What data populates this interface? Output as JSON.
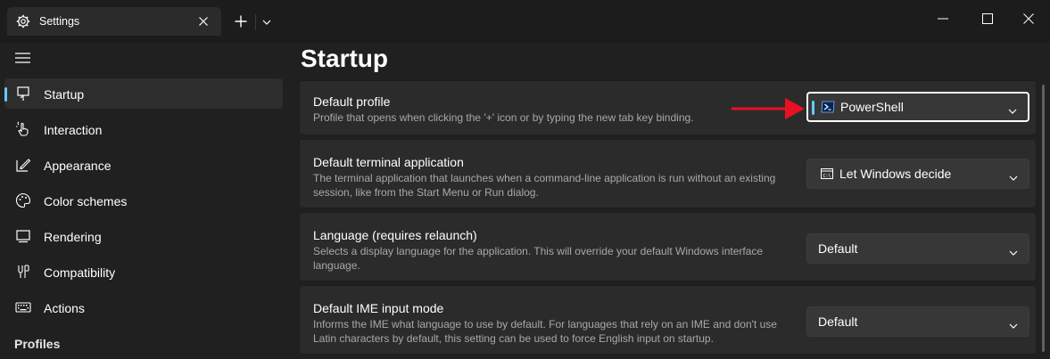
{
  "window": {
    "tab_title": "Settings",
    "icons": {
      "tab": "gear-icon",
      "close": "close-icon",
      "new_tab": "plus-icon",
      "dropdown": "chevron-down-icon",
      "minimize": "minimize-icon",
      "maximize": "maximize-icon",
      "close_window": "close-icon"
    }
  },
  "sidebar": {
    "items": [
      {
        "label": "Startup",
        "icon": "startup-icon",
        "selected": true
      },
      {
        "label": "Interaction",
        "icon": "pointer-hand-icon",
        "selected": false
      },
      {
        "label": "Appearance",
        "icon": "paintbrush-icon",
        "selected": false
      },
      {
        "label": "Color schemes",
        "icon": "palette-icon",
        "selected": false
      },
      {
        "label": "Rendering",
        "icon": "monitor-icon",
        "selected": false
      },
      {
        "label": "Compatibility",
        "icon": "compatibility-icon",
        "selected": false
      },
      {
        "label": "Actions",
        "icon": "keyboard-icon",
        "selected": false
      }
    ],
    "section_header": "Profiles"
  },
  "main": {
    "title": "Startup",
    "settings": [
      {
        "title": "Default profile",
        "description": "Profile that opens when clicking the '+' icon or by typing the new tab key binding.",
        "value": "PowerShell",
        "value_icon": "powershell-icon"
      },
      {
        "title": "Default terminal application",
        "description": "The terminal application that launches when a command-line application is run without an existing session, like from the Start Menu or Run dialog.",
        "value": "Let Windows decide",
        "value_icon": "terminal-app-icon"
      },
      {
        "title": "Language (requires relaunch)",
        "description": "Selects a display language for the application. This will override your default Windows interface language.",
        "value": "Default"
      },
      {
        "title": "Default IME input mode",
        "description": "Informs the IME what language to use by default. For languages that rely on an IME and don't use Latin characters by default, this setting can be used to force English input on startup.",
        "value": "Default"
      }
    ]
  },
  "colors": {
    "background": "#202020",
    "card": "#2b2b2b",
    "accent": "#60cdff",
    "annotation_arrow": "#e81123"
  }
}
